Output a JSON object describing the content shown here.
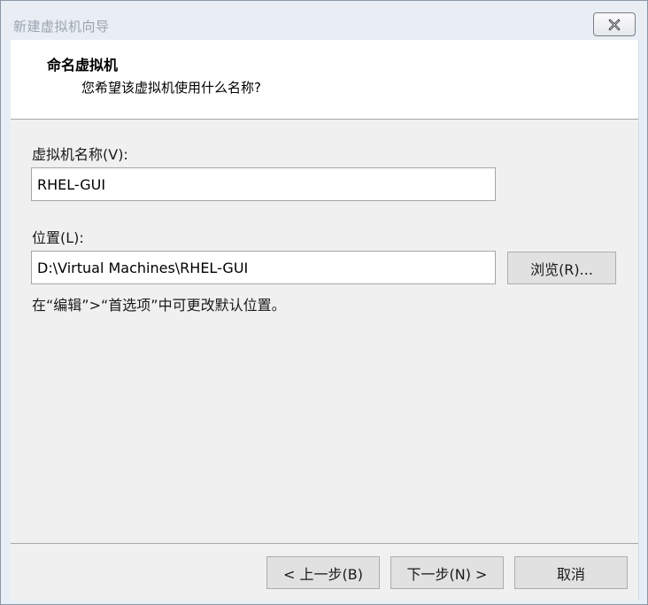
{
  "window": {
    "title": "新建虚拟机向导",
    "close_icon": "close-icon"
  },
  "header": {
    "title": "命名虚拟机",
    "subtitle": "您希望该虚拟机使用什么名称?"
  },
  "form": {
    "name_label": "虚拟机名称(V):",
    "name_value": "RHEL-GUI",
    "location_label": "位置(L):",
    "location_value": "D:\\Virtual Machines\\RHEL-GUI",
    "browse_label": "浏览(R)...",
    "hint": "在“编辑”>“首选项”中可更改默认位置。"
  },
  "footer": {
    "back_label": "< 上一步(B)",
    "next_label": "下一步(N) >",
    "cancel_label": "取消"
  }
}
